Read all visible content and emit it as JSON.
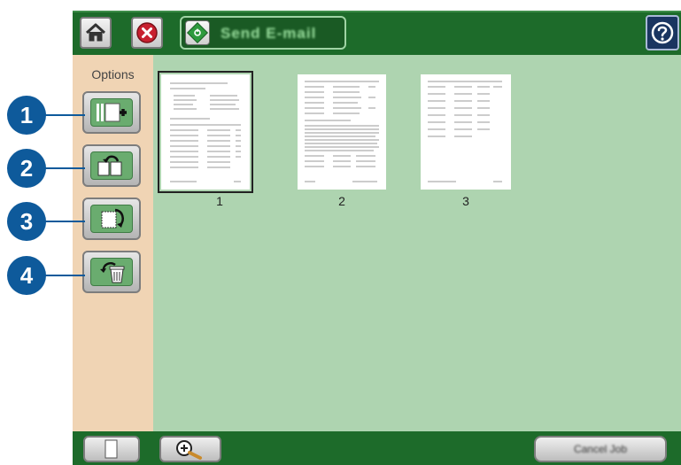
{
  "header": {
    "send_label": "Send E-mail",
    "icons": {
      "home": "home-icon",
      "stop": "stop-icon",
      "start": "start-icon",
      "help": "help-icon"
    },
    "colors": {
      "bar": "#1d6b2a",
      "help": "#1a3560"
    }
  },
  "options_panel": {
    "title": "Options",
    "buttons": [
      {
        "name": "add-page",
        "icon": "add-page-icon"
      },
      {
        "name": "move-page",
        "icon": "move-page-icon"
      },
      {
        "name": "rotate-page",
        "icon": "rotate-page-icon"
      },
      {
        "name": "delete-page",
        "icon": "delete-page-icon"
      }
    ]
  },
  "callouts": [
    "1",
    "2",
    "3",
    "4"
  ],
  "pages": [
    {
      "number": "1",
      "selected": true
    },
    {
      "number": "2",
      "selected": false
    },
    {
      "number": "3",
      "selected": false
    }
  ],
  "footer": {
    "cancel_label": "Cancel Job",
    "icons": {
      "page_view": "blank-page-icon",
      "zoom": "zoom-in-icon"
    }
  }
}
